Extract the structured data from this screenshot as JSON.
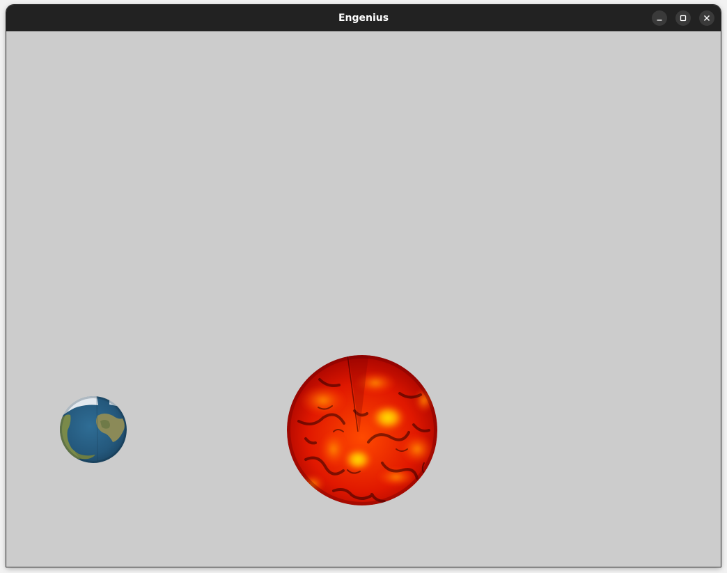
{
  "window": {
    "title": "Engenius"
  },
  "controls": {
    "minimize": "minimize-icon",
    "maximize": "maximize-icon",
    "close": "close-icon"
  },
  "scene": {
    "background_color": "#cccccc",
    "objects": [
      {
        "name": "earth",
        "colors": [
          "#2a5f86",
          "#8c8a52",
          "#dde6ee"
        ]
      },
      {
        "name": "sun",
        "colors": [
          "#b00000",
          "#ff3a00",
          "#ffc400"
        ]
      }
    ]
  }
}
